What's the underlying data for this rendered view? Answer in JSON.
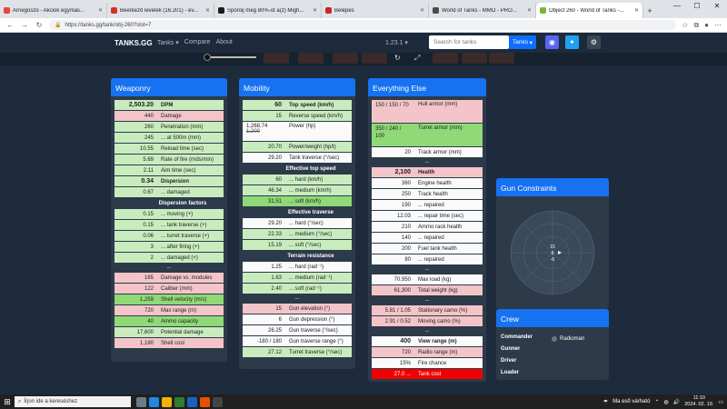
{
  "browser": {
    "tabs": [
      {
        "title": "Árnegoszó - Akciók egymás...",
        "color": "#e8453c"
      },
      {
        "title": "Beérkező levelek (16.201) - ev...",
        "color": "#d93025"
      },
      {
        "title": "Spórolj meg 80%-ot a(z) Migh...",
        "color": "#1a1a1a"
      },
      {
        "title": "Belépés",
        "color": "#c62828"
      },
      {
        "title": "World of Tanks - MMO - PRO...",
        "color": "#4a4a4a"
      },
      {
        "title": "Object 260 - World of Tanks -...",
        "color": "#7cb342"
      }
    ],
    "url": "https://tanks.gg/tank/obj-260?slot=7"
  },
  "site": {
    "brand": "TANKS.GG",
    "nav": [
      "Tanks",
      "Compare",
      "About"
    ],
    "version": "1.23.1",
    "search_placeholder": "Search for tanks",
    "tanks_button": "Tanks"
  },
  "weaponry": {
    "title": "Weaponry",
    "rows": [
      {
        "v": "2,503.20",
        "l": "DPM",
        "c": "green",
        "big": true,
        "bold": true
      },
      {
        "v": "440",
        "l": "Damage",
        "c": "pink"
      },
      {
        "v": "260",
        "l": "Penetration (mm)",
        "c": "green"
      },
      {
        "v": "245",
        "l": "... at 500m (mm)",
        "c": "green"
      },
      {
        "v": "10.55",
        "l": "Reload time (sec)",
        "c": "green"
      },
      {
        "v": "5.69",
        "l": "Rate of fire (rnds/min)",
        "c": "green"
      },
      {
        "v": "2.11",
        "l": "Aim time (sec)",
        "c": "green"
      },
      {
        "v": "0.34",
        "l": "Dispersion",
        "c": "green",
        "big": true,
        "bold": true
      },
      {
        "v": "0.67",
        "l": "... damaged",
        "c": "green"
      }
    ],
    "dispersion_header": "Dispersion factors",
    "dispersion_rows": [
      {
        "v": "0.15",
        "l": "... moving (+)",
        "c": "green"
      },
      {
        "v": "0.15",
        "l": "... tank traverse (+)",
        "c": "green"
      },
      {
        "v": "0.06",
        "l": "... turret traverse (+)",
        "c": "green"
      },
      {
        "v": "3",
        "l": "... after firing (+)",
        "c": "green"
      },
      {
        "v": "2",
        "l": "... damaged (×)",
        "c": "green"
      }
    ],
    "dots": "...",
    "more_rows": [
      {
        "v": "165",
        "l": "Damage vs. modules",
        "c": "pink"
      },
      {
        "v": "122",
        "l": "Caliber (mm)",
        "c": "pink"
      },
      {
        "v": "1,259",
        "l": "Shell velocity (m/s)",
        "c": "dgreen"
      },
      {
        "v": "720",
        "l": "Max range (m)",
        "c": "pink"
      },
      {
        "v": "40",
        "l": "Ammo capacity",
        "c": "dgreen"
      },
      {
        "v": "17,600",
        "l": "Potential damage",
        "c": "green"
      },
      {
        "v": "1,180",
        "l": "Shell cost",
        "c": "pink"
      }
    ]
  },
  "mobility": {
    "title": "Mobility",
    "rows": [
      {
        "v": "60",
        "l": "Top speed (km/h)",
        "c": "green",
        "big": true,
        "bold": true
      },
      {
        "v": "15",
        "l": "Reverse speed (km/h)",
        "c": "green"
      }
    ],
    "power": {
      "v": "1,268.74",
      "old": "1,200",
      "l": "Power (hp)"
    },
    "rows2": [
      {
        "v": "20.70",
        "l": "Power/weight (hp/t)",
        "c": "green"
      },
      {
        "v": "29.20",
        "l": "Tank traverse (°/sec)",
        "c": "white"
      }
    ],
    "eff_speed_header": "Effective top speed",
    "eff_speed_rows": [
      {
        "v": "60",
        "l": "... hard (km/h)",
        "c": "green"
      },
      {
        "v": "46.34",
        "l": "... medium (km/h)",
        "c": "green"
      },
      {
        "v": "31.51",
        "l": "... soft (km/h)",
        "c": "dgreen"
      }
    ],
    "eff_trav_header": "Effective traverse",
    "eff_trav_rows": [
      {
        "v": "29.20",
        "l": "... hard (°/sec)",
        "c": "white"
      },
      {
        "v": "22.33",
        "l": "... medium (°/sec)",
        "c": "green"
      },
      {
        "v": "15.19",
        "l": "... soft (°/sec)",
        "c": "green"
      }
    ],
    "terrain_header": "Terrain resistance",
    "terrain_rows": [
      {
        "v": "1.25",
        "l": "... hard (rad⁻¹)",
        "c": "white"
      },
      {
        "v": "1.63",
        "l": "... medium (rad⁻¹)",
        "c": "green"
      },
      {
        "v": "2.40",
        "l": "... soft (rad⁻¹)",
        "c": "green"
      }
    ],
    "dots": "...",
    "more_rows": [
      {
        "v": "15",
        "l": "Gun elevation (°)",
        "c": "pink"
      },
      {
        "v": "6",
        "l": "Gun depression (°)",
        "c": "white"
      },
      {
        "v": "26.25",
        "l": "Gun traverse (°/sec)",
        "c": "white"
      },
      {
        "v": "-180 / 180",
        "l": "Gun traverse range (°)",
        "c": "white"
      },
      {
        "v": "27.12",
        "l": "Turret traverse (°/sec)",
        "c": "green"
      }
    ]
  },
  "everything": {
    "title": "Everything Else",
    "hull": {
      "v": "150 / 150 / 70",
      "l": "Hull armor (mm)"
    },
    "turret": {
      "v": "350 / 240 / 100",
      "l": "Turret armor (mm)"
    },
    "rows": [
      {
        "v": "20",
        "l": "Track armor (mm)",
        "c": "white"
      }
    ],
    "dots": "...",
    "rows2": [
      {
        "v": "2,100",
        "l": "Health",
        "c": "pink",
        "big": true,
        "bold": true
      },
      {
        "v": "360",
        "l": "Engine health",
        "c": "white"
      },
      {
        "v": "250",
        "l": "Track health",
        "c": "white"
      },
      {
        "v": "190",
        "l": "... repaired",
        "c": "white"
      },
      {
        "v": "12.03",
        "l": "... repair time (sec)",
        "c": "white"
      },
      {
        "v": "210",
        "l": "Ammo rack health",
        "c": "white"
      },
      {
        "v": "140",
        "l": "... repaired",
        "c": "white"
      },
      {
        "v": "200",
        "l": "Fuel tank health",
        "c": "white"
      },
      {
        "v": "80",
        "l": "... repaired",
        "c": "white"
      }
    ],
    "rows3": [
      {
        "v": "70,950",
        "l": "Max load (kg)",
        "c": "white"
      },
      {
        "v": "61,300",
        "l": "Total weight (kg)",
        "c": "pink"
      }
    ],
    "rows4": [
      {
        "v": "5.81 / 1.05",
        "l": "Stationary camo (%)",
        "c": "pink"
      },
      {
        "v": "2.91 / 0.52",
        "l": "Moving camo (%)",
        "c": "pink"
      }
    ],
    "rows5": [
      {
        "v": "400",
        "l": "View range (m)",
        "c": "white",
        "big": true,
        "bold": true
      },
      {
        "v": "720",
        "l": "Radio range (m)",
        "c": "pink"
      },
      {
        "v": "15%",
        "l": "Fire chance",
        "c": "white"
      },
      {
        "v": "27.0 ...",
        "l": "Tank cost",
        "c": "red"
      }
    ]
  },
  "gun_constraints": {
    "title": "Gun Constraints",
    "labels": [
      "15",
      "6",
      "-6"
    ]
  },
  "crew": {
    "title": "Crew",
    "rows": [
      {
        "role": "Commander",
        "name": "Radioman"
      },
      {
        "role": "Gunner",
        "name": ""
      },
      {
        "role": "Driver",
        "name": ""
      },
      {
        "role": "Loader",
        "name": ""
      }
    ]
  },
  "taskbar": {
    "search": "Írjon ide a kereséshez",
    "weather": "Ma eső várható",
    "time": "11:10",
    "date": "2024. 02. 19."
  }
}
